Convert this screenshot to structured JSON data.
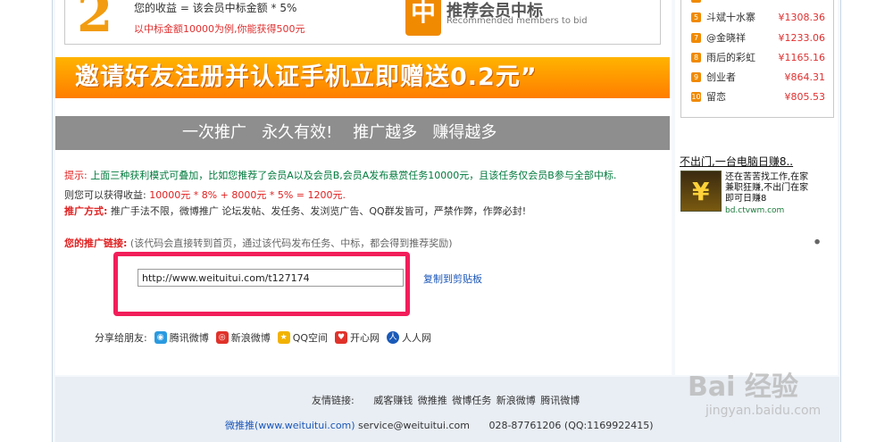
{
  "earnings": {
    "big_number": "2",
    "line1": "您的收益 = 该会员中标金额 * 5%",
    "line2": "以中标金额10000为例,你能获得500元"
  },
  "promo": {
    "badge": "中",
    "title": "推荐会员中标",
    "subtitle": "Recommended members to bid"
  },
  "invite_banner": "邀请好友注册并认证手机立即赠送0.2元”",
  "slogan": "一次推广   永久有效!    推广越多   赚得越多",
  "tips": {
    "prefix": "提示:",
    "text": " 上面三种获利模式可叠加，比如您推荐了会员A以及会员B,会员A发布悬赏任务10000元，且该任务仅会员B参与全部中标.",
    "earn_prefix": "则您可以获得收益: ",
    "earn_formula": "10000元 * 8% + 8000元 * 5% = 1200元.",
    "method_label": "推广方式:",
    "method_text": " 推广手法不限，微博推广 论坛发帖、发任务、发浏览广告、QQ群发皆可，严禁作弊，作弊必封!"
  },
  "promo_link": {
    "label": "您的推广链接:",
    "note": " (该代码会直接转到首页，通过该代码发布任务、中标，都会得到推荐奖励)",
    "value": "http://www.weituitui.com/t127174",
    "copy_label": "复制到剪贴板"
  },
  "share": {
    "label": "分享给朋友:",
    "items": [
      {
        "label": "腾讯微博",
        "icon": "tencent-weibo-icon",
        "color": "#2a9ae0"
      },
      {
        "label": "新浪微博",
        "icon": "sina-weibo-icon",
        "color": "#e0322a"
      },
      {
        "label": "QQ空间",
        "icon": "qzone-icon",
        "color": "#f2b200"
      },
      {
        "label": "开心网",
        "icon": "kaixin-icon",
        "color": "#e0322a"
      },
      {
        "label": "人人网",
        "icon": "renren-icon",
        "color": "#1a5ab8"
      }
    ]
  },
  "footer": {
    "friend_label": "友情链接:",
    "friend_links": [
      "威客赚钱",
      "微推推",
      "微博任务",
      "新浪微博",
      "腾讯微博"
    ],
    "site_name": "微推推(www.weituitui.com)",
    "email": " service@weituitui.com",
    "phone": "028-87761206 (QQ:1169922415)"
  },
  "ranking": [
    {
      "num": "5",
      "name": "斗斌十水寨",
      "amount": "¥1308.36"
    },
    {
      "num": "7",
      "name": "@金晓祥",
      "amount": "¥1233.06"
    },
    {
      "num": "8",
      "name": "雨后的彩虹",
      "amount": "¥1165.16"
    },
    {
      "num": "9",
      "name": "创业者",
      "amount": "¥864.31"
    },
    {
      "num": "10",
      "name": "留恋",
      "amount": "¥805.53"
    }
  ],
  "ad": {
    "title": "不出门,一台电脑日赚8..",
    "text": "还在苦苦找工作,在家兼职狂赚,不出门在家即可日赚8",
    "url": "bd.ctvwm.com"
  },
  "watermark": {
    "main": "Bai 经验",
    "sub": "jingyan.baidu.com"
  }
}
